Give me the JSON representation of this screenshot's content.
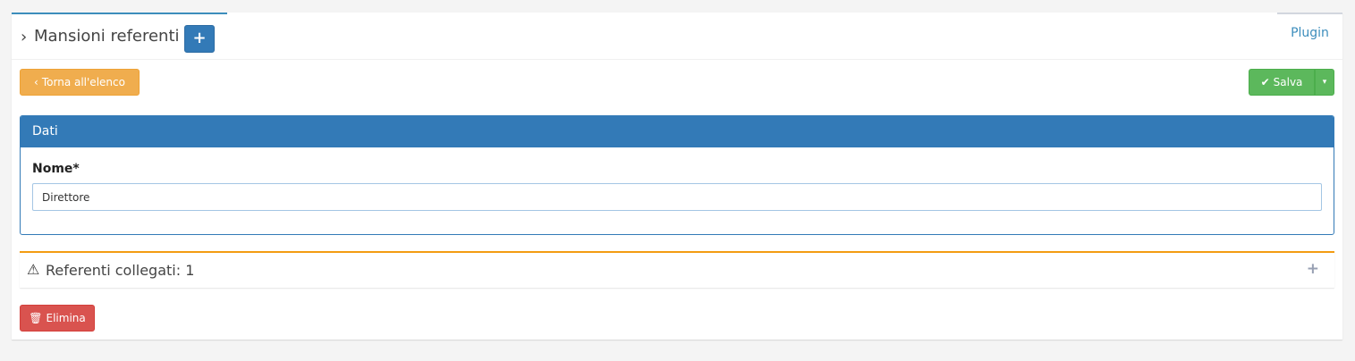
{
  "tabs": {
    "active_title": "Mansioni referenti",
    "add_symbol": "+",
    "plugin_label": "Plugin"
  },
  "toolbar": {
    "back_label": "Torna all'elenco",
    "save_label": "Salva"
  },
  "panel": {
    "title": "Dati",
    "field_label": "Nome*",
    "field_value": "Direttore"
  },
  "linked": {
    "title": "Referenti collegati: 1",
    "expand_symbol": "+"
  },
  "actions": {
    "delete_label": "Elimina"
  },
  "colors": {
    "primary": "#337ab7",
    "warning": "#f0ad4e",
    "success": "#5cb85c",
    "danger": "#d9534f",
    "accent_border": "#f39c12"
  },
  "icons": {
    "tab_chevron": "chevron-right-icon",
    "back": "chevron-left-icon",
    "save": "check-icon",
    "save_dropdown": "caret-down-icon",
    "linked_warning": "warning-icon",
    "delete": "trash-icon"
  }
}
